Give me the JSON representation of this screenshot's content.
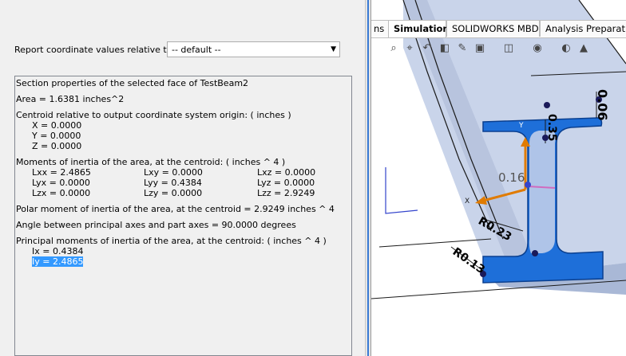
{
  "dialog": {
    "coord_label": "Report coordinate values relative to:",
    "coord_select_value": "-- default --",
    "lines": {
      "header": "Section properties of the selected face of TestBeam2",
      "area": "Area = 1.6381 inches^2",
      "centroid_title": "Centroid relative to output coordinate system origin: ( inches )",
      "cx": "X = 0.0000",
      "cy": "Y = 0.0000",
      "cz": "Z = 0.0000",
      "moi_title": "Moments of inertia of the area, at the centroid: ( inches ^ 4 )",
      "lxx": "Lxx = 2.4865",
      "lxy": "Lxy = 0.0000",
      "lxz": "Lxz = 0.0000",
      "lyx": "Lyx = 0.0000",
      "lyy": "Lyy = 0.4384",
      "lyz": "Lyz = 0.0000",
      "lzx": "Lzx = 0.0000",
      "lzy": "Lzy = 0.0000",
      "lzz": "Lzz = 2.9249",
      "polar": "Polar moment of inertia of the area, at the centroid = 2.9249 inches ^ 4",
      "angle": "Angle between principal axes and part axes = 90.0000 degrees",
      "principal_title": "Principal moments of inertia of the area, at the centroid: ( inches ^ 4 )",
      "ix": "Ix = 0.4384",
      "iy": "Iy = 2.4865"
    }
  },
  "tabs": [
    {
      "label": "ns",
      "active": false
    },
    {
      "label": "Simulation",
      "active": true
    },
    {
      "label": "SOLIDWORKS MBD",
      "active": false
    },
    {
      "label": "Analysis Preparation",
      "active": false
    }
  ],
  "viewport": {
    "dimensions": [
      "0.06",
      "0.35",
      "0.16",
      "R0.23",
      "R0.13"
    ],
    "axis_labels": [
      "Y",
      "X"
    ],
    "colors": {
      "face": "#1e6fd9",
      "body": "#c9d4ea",
      "edge": "#1a1a1a",
      "divider_accent": "#3a7bd5"
    }
  },
  "icons": [
    "zoom-to-fit-icon",
    "zoom-area-icon",
    "previous-view-icon",
    "section-view-icon",
    "dynamic-annotation-icon",
    "view-orientation-icon",
    "display-style-icon",
    "hide-show-icon",
    "edit-appearance-icon",
    "apply-scene-icon"
  ]
}
